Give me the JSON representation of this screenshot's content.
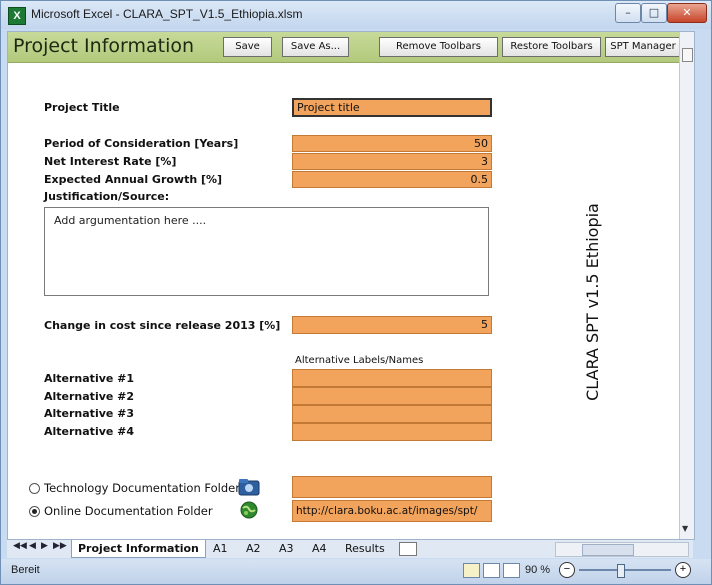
{
  "window": {
    "title": "Microsoft Excel - CLARA_SPT_V1.5_Ethiopia.xlsm",
    "app_icon_letter": "X",
    "min_glyph": "–",
    "max_glyph": "□",
    "close_glyph": "✕"
  },
  "header": {
    "title": "Project Information",
    "buttons": [
      "Save",
      "Save As...",
      "Remove Toolbars",
      "Restore Toolbars",
      "SPT Manager"
    ]
  },
  "form": {
    "project_title_label": "Project Title",
    "project_title_value": "Project title",
    "period_label": "Period of Consideration [Years]",
    "period_value": "50",
    "interest_label": "Net Interest Rate [%]",
    "interest_value": "3",
    "growth_label": "Expected Annual Growth [%]",
    "growth_value": "0.5",
    "justification_label": "Justification/Source:",
    "justification_text": "Add argumentation here ....",
    "cost_change_label": "Change in cost since release 2013 [%]",
    "cost_change_value": "5",
    "alt_header": "Alternative Labels/Names",
    "alternatives": [
      "Alternative #1",
      "Alternative #2",
      "Alternative #3",
      "Alternative #4"
    ],
    "tech_doc_label": "Technology Documentation Folder",
    "tech_doc_value": "",
    "online_doc_label": "Online Documentation Folder",
    "online_doc_value": "http://clara.boku.ac.at/images/spt/",
    "selected_doc_option": "online"
  },
  "side_label": "CLARA SPT v1.5 Ethiopia",
  "tabs": {
    "nav": [
      "◀◀",
      "◀",
      "▶",
      "▶▶"
    ],
    "items": [
      "Project Information",
      "A1",
      "A2",
      "A3",
      "A4",
      "Results"
    ],
    "active": "Project Information"
  },
  "status": {
    "ready_text": "Bereit",
    "zoom_text": "90 %",
    "zoom_level_percent": 90,
    "minus_glyph": "−",
    "plus_glyph": "+"
  },
  "colors": {
    "input_fill": "#f2a35c",
    "header_band": "#b9ce87"
  }
}
